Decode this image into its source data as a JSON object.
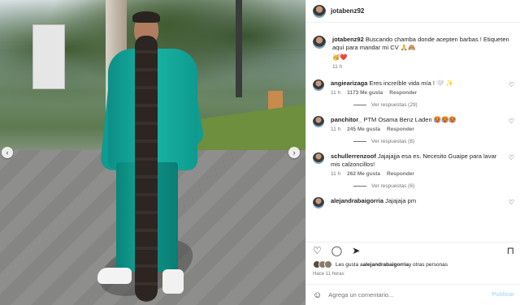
{
  "photo": {
    "prev_arrow": "‹",
    "next_arrow": "›"
  },
  "post": {
    "username": "jotabenz92",
    "caption_username": "jotabenz92",
    "caption_text": "Buscando chamba donde acepten barbas ! Etiqueten aquí para mandar mi CV 🙏🙈",
    "caption_emojis": "🥳❤️",
    "caption_time": "11 h"
  },
  "comments": [
    {
      "username": "angiearizaga",
      "text": "Eres increíble vida mía ! 🤍 ✨",
      "time": "11 h",
      "likes": "1173 Me gusta",
      "reply": "Responder",
      "replies_label": "Ver respuestas (29)"
    },
    {
      "username": "panchitor_",
      "text": "PTM Osama Benz Laden 🥵🥵🥵",
      "time": "11 h",
      "likes": "245 Me gusta",
      "reply": "Responder",
      "replies_label": "Ver respuestas (8)"
    },
    {
      "username": "schullerrenzoof",
      "text": "Jajajajja esa es. Necesito Guaipe para lavar mis calzoncillos!",
      "time": "11 h",
      "likes": "262 Me gusta",
      "reply": "Responder",
      "replies_label": "Ver respuestas (6)"
    },
    {
      "username": "alejandrabaigorria",
      "text": "Jajajaja pm",
      "time": "",
      "likes": "",
      "reply": "",
      "replies_label": ""
    }
  ],
  "likes_line": {
    "prefix": "Les gusta a ",
    "user": "alejandrabaigorria",
    "suffix": " y otras personas"
  },
  "time_ago": "Hace 11 horas",
  "add_comment": {
    "placeholder": "Agrega un comentario...",
    "publish": "Publicar"
  },
  "icons": {
    "heart": "♡",
    "comment": "◯",
    "share": "➤",
    "save": "⊓",
    "smile": "☺"
  }
}
